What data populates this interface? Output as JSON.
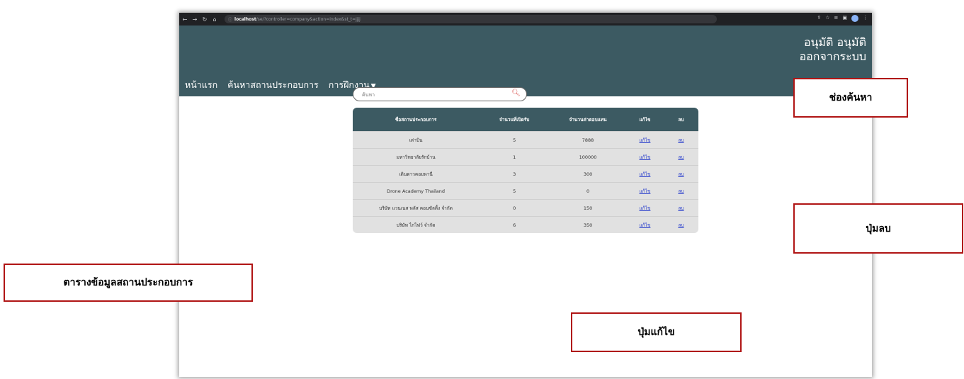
{
  "browser": {
    "host": "localhost",
    "path": "/se/?controller=company&action=index&st_t=jjjj"
  },
  "header": {
    "user_name": "อนุมัติ อนุมัติ",
    "logout": "ออกจากระบบ",
    "nav": [
      "หน้าแรก",
      "ค้นหาสถานประกอบการ",
      "การฝึกงาน"
    ]
  },
  "search": {
    "placeholder": "ค้นหา"
  },
  "table": {
    "headers": [
      "ชื่อสถานประกอบการ",
      "จำนวนที่เปิดรับ",
      "จำนวนค่าตอบแทน",
      "แก้ไข",
      "ลบ"
    ],
    "rows": [
      {
        "name": "เต่าบิน",
        "open": "5",
        "pay": "7888"
      },
      {
        "name": "มหาวิทยาลัยรักบ้าน",
        "open": "1",
        "pay": "100000"
      },
      {
        "name": "เดินดาวคอมพานี",
        "open": "3",
        "pay": "300"
      },
      {
        "name": "Drone Academy Thailand",
        "open": "5",
        "pay": "0"
      },
      {
        "name": "บริษัท แวนเนส พลัส คอนซัลติ้ง จำกัด",
        "open": "0",
        "pay": "150"
      },
      {
        "name": "บริษัท ไกไฟว์ จำกัด",
        "open": "6",
        "pay": "350"
      }
    ],
    "edit_label": "แก้ไข",
    "delete_label": "ลบ"
  },
  "callouts": {
    "search": "ช่องค้นหา",
    "delete": "ปุ่มลบ",
    "table": "ตารางข้อมูลสถานประกอบการ",
    "edit": "ปุ่มแก้ไข"
  },
  "colors": {
    "header": "#3c5a62",
    "callout_border": "#b01414"
  }
}
